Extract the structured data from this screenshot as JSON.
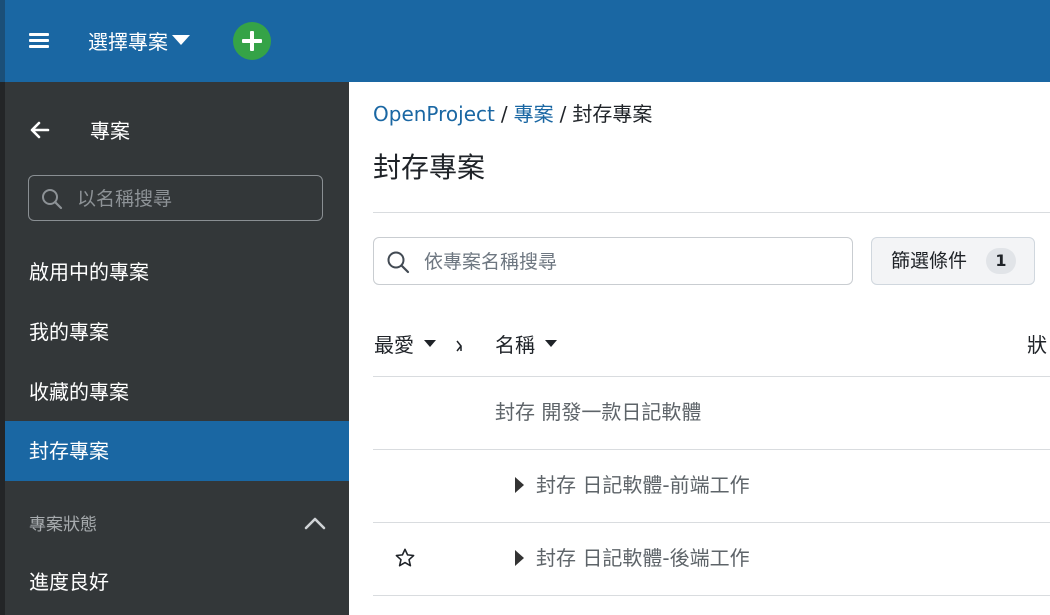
{
  "header": {
    "project_select": "選擇專案"
  },
  "sidebar": {
    "title": "專案",
    "search_placeholder": "以名稱搜尋",
    "items": [
      {
        "label": "啟用中的專案"
      },
      {
        "label": "我的專案"
      },
      {
        "label": "收藏的專案"
      },
      {
        "label": "封存專案"
      }
    ],
    "active_item": "封存專案",
    "section_header": "專案狀態",
    "section_items": [
      {
        "label": "進度良好"
      }
    ]
  },
  "main": {
    "breadcrumb": {
      "root": "OpenProject",
      "parent": "專案",
      "current": "封存專案"
    },
    "title": "封存專案",
    "search_placeholder": "依專案名稱搜尋",
    "filter": {
      "label": "篩選條件",
      "count": "1"
    },
    "columns": {
      "favorite": "最愛",
      "name": "名稱",
      "status": "狀"
    },
    "rows": [
      {
        "name": "封存 開發一款日記軟體"
      },
      {
        "name": "封存 日記軟體-前端工作"
      },
      {
        "name": "封存 日記軟體-後端工作"
      }
    ]
  },
  "colors": {
    "accent": "#1a67a3",
    "sidebar_bg": "#333739",
    "add_button": "#35a347"
  }
}
